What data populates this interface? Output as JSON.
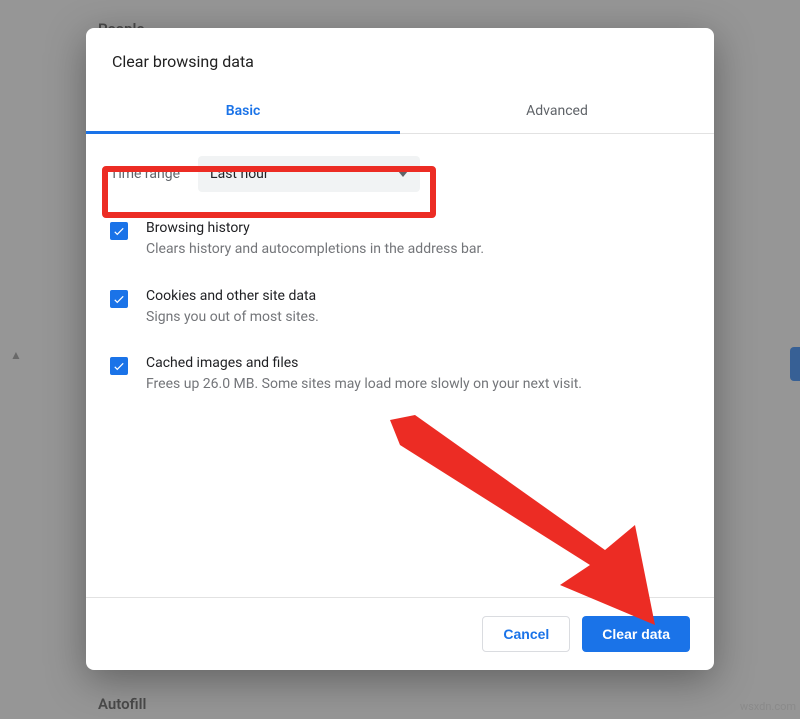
{
  "background": {
    "section_people": "People",
    "section_autofill": "Autofill"
  },
  "modal": {
    "title": "Clear browsing data",
    "tabs": {
      "basic": "Basic",
      "advanced": "Advanced"
    },
    "time_label": "Time range",
    "time_value": "Last hour",
    "options": [
      {
        "title": "Browsing history",
        "sub": "Clears history and autocompletions in the address bar.",
        "checked": true
      },
      {
        "title": "Cookies and other site data",
        "sub": "Signs you out of most sites.",
        "checked": true
      },
      {
        "title": "Cached images and files",
        "sub": "Frees up 26.0 MB. Some sites may load more slowly on your next visit.",
        "checked": true
      }
    ],
    "cancel": "Cancel",
    "confirm": "Clear data"
  },
  "watermark": "wsxdn.com"
}
